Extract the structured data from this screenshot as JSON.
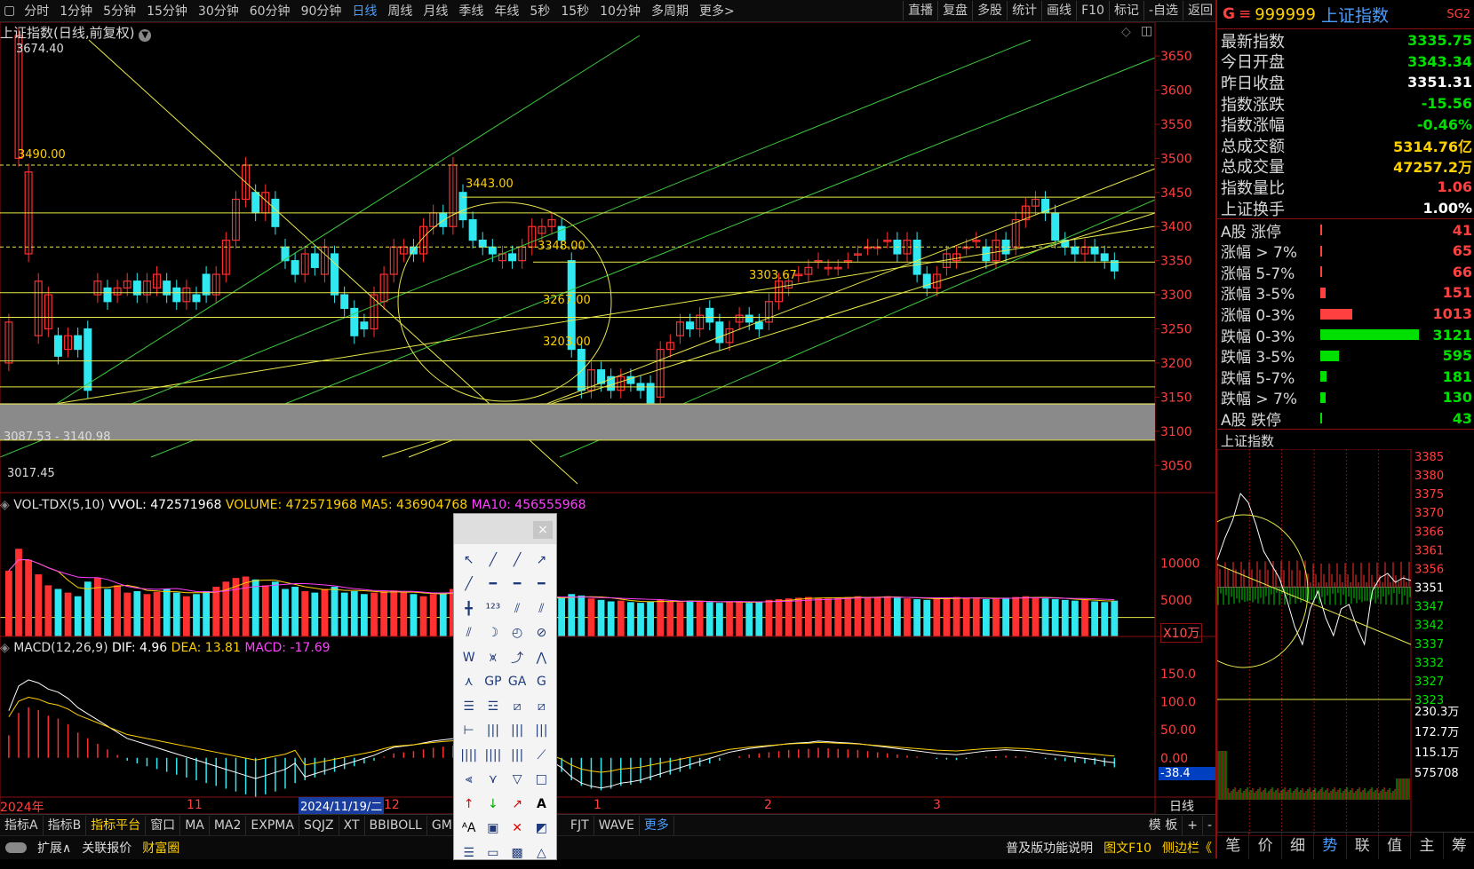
{
  "toolbar": {
    "periods": [
      "分时",
      "1分钟",
      "5分钟",
      "15分钟",
      "30分钟",
      "60分钟",
      "90分钟",
      "日线",
      "周线",
      "月线",
      "季线",
      "年线",
      "5秒",
      "15秒",
      "10分钟",
      "多周期",
      "更多>"
    ],
    "active_period": "日线",
    "right": [
      "直播",
      "复盘",
      "多股",
      "统计",
      "画线",
      "F10",
      "标记",
      "-自选",
      "返回"
    ]
  },
  "main": {
    "title": "上证指数(日线,前复权)",
    "labels": {
      "high": "3674.40",
      "l3490": "3490.00",
      "l3443": "3443.00",
      "l3348": "3348.00",
      "l3303": "3303.67",
      "l3267": "3267.00",
      "l3203": "3203.00",
      "band": "3087.53 - 3140.98",
      "low": "3017.45"
    },
    "vol_header": {
      "name": "VOL-TDX(5,10)",
      "vvol": "VVOL: 472571968",
      "volume": "VOLUME: 472571968",
      "ma5": "MA5: 436904768",
      "ma10": "MA10: 456555968"
    },
    "macd_header": {
      "name": "MACD(12,26,9)",
      "dif": "DIF: 4.96",
      "dea": "DEA: 13.81",
      "macd": "MACD: -17.69"
    },
    "vol_unit": "X10万",
    "macd_cursor": "-38.4",
    "xaxis": {
      "year": "2024年",
      "m11": "11",
      "cursor": "2024/11/19/二",
      "m12": "12",
      "m1": "1",
      "m2": "2",
      "m3": "3",
      "period": "日线"
    }
  },
  "chart_data": {
    "type": "candlestick",
    "y_ticks": [
      "3650",
      "3600",
      "3550",
      "3500",
      "3450",
      "3400",
      "3350",
      "3300",
      "3250",
      "3200",
      "3150",
      "3100",
      "3050"
    ],
    "ylim": [
      3010,
      3680
    ],
    "vol_ticks": [
      "10000",
      "5000"
    ],
    "macd_ticks": [
      "150.0",
      "100.0",
      "50.00",
      "0.00"
    ],
    "closes": [
      3260,
      3680,
      3480,
      3320,
      3300,
      3210,
      3240,
      3220,
      3160,
      3320,
      3290,
      3310,
      3320,
      3300,
      3320,
      3330,
      3300,
      3290,
      3310,
      3290,
      3300,
      3330,
      3380,
      3440,
      3490,
      3420,
      3450,
      3400,
      3350,
      3330,
      3360,
      3340,
      3370,
      3300,
      3280,
      3240,
      3250,
      3300,
      3330,
      3370,
      3370,
      3360,
      3400,
      3420,
      3400,
      3490,
      3410,
      3380,
      3370,
      3360,
      3360,
      3350,
      3370,
      3400,
      3400,
      3410,
      3380,
      3220,
      3160,
      3190,
      3170,
      3160,
      3180,
      3170,
      3160,
      3140,
      3220,
      3230,
      3260,
      3250,
      3270,
      3260,
      3230,
      3250,
      3270,
      3260,
      3250,
      3290,
      3320,
      3320,
      3330,
      3340,
      3350,
      3340,
      3340,
      3350,
      3360,
      3370,
      3370,
      3380,
      3360,
      3380,
      3330,
      3310,
      3330,
      3360,
      3360,
      3370,
      3380,
      3350,
      3380,
      3360,
      3410,
      3430,
      3440,
      3420,
      3380,
      3370,
      3360,
      3370,
      3360,
      3350,
      3335
    ],
    "opens": [
      3200,
      3500,
      3360,
      3240,
      3250,
      3240,
      3220,
      3240,
      3250,
      3300,
      3310,
      3300,
      3310,
      3320,
      3300,
      3310,
      3320,
      3310,
      3290,
      3300,
      3330,
      3300,
      3330,
      3380,
      3440,
      3450,
      3420,
      3440,
      3370,
      3350,
      3330,
      3360,
      3330,
      3360,
      3300,
      3280,
      3260,
      3250,
      3290,
      3330,
      3360,
      3370,
      3360,
      3400,
      3420,
      3400,
      3450,
      3410,
      3380,
      3370,
      3350,
      3360,
      3350,
      3370,
      3390,
      3400,
      3400,
      3350,
      3220,
      3160,
      3190,
      3180,
      3160,
      3180,
      3170,
      3170,
      3150,
      3220,
      3240,
      3260,
      3250,
      3280,
      3260,
      3230,
      3260,
      3270,
      3260,
      3260,
      3290,
      3310,
      3330,
      3330,
      3350,
      3340,
      3340,
      3350,
      3360,
      3370,
      3370,
      3380,
      3380,
      3360,
      3380,
      3330,
      3310,
      3340,
      3350,
      3370,
      3380,
      3370,
      3350,
      3380,
      3370,
      3410,
      3430,
      3440,
      3420,
      3380,
      3370,
      3360,
      3370,
      3360,
      3350
    ],
    "volumes": [
      9000,
      12000,
      10500,
      8500,
      7000,
      6500,
      6000,
      5500,
      7500,
      8000,
      6500,
      7000,
      6000,
      6200,
      5800,
      6100,
      6500,
      6000,
      5500,
      5800,
      6200,
      6800,
      7500,
      8000,
      8200,
      7800,
      7000,
      7500,
      6500,
      6800,
      6200,
      6000,
      6500,
      6800,
      6000,
      6200,
      5800,
      6000,
      6200,
      6300,
      6000,
      5800,
      5500,
      5800,
      6000,
      6500,
      6200,
      5800,
      5500,
      5600,
      5400,
      5200,
      5500,
      5300,
      5000,
      5200,
      5400,
      5800,
      5600,
      5200,
      5000,
      4800,
      4900,
      4700,
      4600,
      4800,
      5000,
      4800,
      4700,
      4900,
      4800,
      4700,
      4600,
      4800,
      4700,
      4600,
      4800,
      5000,
      5100,
      5200,
      5300,
      5400,
      5300,
      5200,
      5300,
      5400,
      5500,
      5300,
      5400,
      5500,
      5300,
      5200,
      5100,
      5000,
      5200,
      5300,
      5400,
      5300,
      5200,
      5100,
      5200,
      5300,
      5400,
      5500,
      5300,
      5200,
      5100,
      5000,
      4900,
      5000,
      4800,
      4700,
      4900
    ],
    "macd_hist": [
      40,
      80,
      90,
      85,
      75,
      70,
      60,
      45,
      35,
      25,
      15,
      5,
      -5,
      -10,
      -15,
      -20,
      -25,
      -30,
      -35,
      -40,
      -45,
      -50,
      -55,
      -60,
      -65,
      -70,
      -65,
      -60,
      -55,
      -45,
      -40,
      -35,
      -30,
      -25,
      -20,
      -15,
      -10,
      -5,
      2,
      8,
      10,
      12,
      15,
      18,
      20,
      22,
      18,
      14,
      10,
      6,
      2,
      -2,
      -5,
      -8,
      -10,
      -15,
      -25,
      -40,
      -50,
      -55,
      -58,
      -55,
      -50,
      -48,
      -45,
      -40,
      -35,
      -30,
      -25,
      -20,
      -15,
      -10,
      -5,
      0,
      3,
      6,
      8,
      10,
      12,
      14,
      15,
      16,
      18,
      17,
      16,
      15,
      14,
      12,
      10,
      8,
      6,
      4,
      2,
      0,
      -2,
      -3,
      -4,
      -2,
      0,
      2,
      3,
      4,
      3,
      2,
      0,
      -2,
      -4,
      -6,
      -8,
      -10,
      -12,
      -15,
      -17
    ],
    "trend": {
      "label": "上证指数",
      "ticks": [
        "3385",
        "3380",
        "3375",
        "3370",
        "3366",
        "3361",
        "3356",
        "3351",
        "3347",
        "3342",
        "3337",
        "3332",
        "3327",
        "3323"
      ],
      "vol_ticks": [
        "230.3万",
        "172.7万",
        "115.1万",
        "575708"
      ]
    }
  },
  "quote": {
    "code": "999999",
    "name": "上证指数",
    "badge": "SG2",
    "prefix": "G",
    "rows": [
      {
        "label": "最新指数",
        "value": "3335.75",
        "color": "#00e000"
      },
      {
        "label": "今日开盘",
        "value": "3343.34",
        "color": "#00e000"
      },
      {
        "label": "昨日收盘",
        "value": "3351.31",
        "color": "#ffffff"
      },
      {
        "label": "指数涨跌",
        "value": "-15.56",
        "color": "#00e000"
      },
      {
        "label": "指数涨幅",
        "value": "-0.46%",
        "color": "#00e000"
      },
      {
        "label": "总成交额",
        "value": "5314.76亿",
        "color": "#ffd000"
      },
      {
        "label": "总成交量",
        "value": "47257.2万",
        "color": "#ffd000"
      },
      {
        "label": "指数量比",
        "value": "1.06",
        "color": "#ff4040"
      },
      {
        "label": "上证换手",
        "value": "1.00%",
        "color": "#ffffff"
      }
    ],
    "breadth": [
      {
        "label": "A股 涨停",
        "count": "41",
        "color": "#ff4040",
        "frac": 0.02
      },
      {
        "label": "涨幅 > 7%",
        "count": "65",
        "color": "#ff4040",
        "frac": 0.02
      },
      {
        "label": "涨幅 5-7%",
        "count": "66",
        "color": "#ff4040",
        "frac": 0.02
      },
      {
        "label": "涨幅 3-5%",
        "count": "151",
        "color": "#ff4040",
        "frac": 0.05
      },
      {
        "label": "涨幅 0-3%",
        "count": "1013",
        "color": "#ff4040",
        "frac": 0.32
      },
      {
        "label": "跌幅 0-3%",
        "count": "3121",
        "color": "#00e000",
        "frac": 1.0
      },
      {
        "label": "跌幅 3-5%",
        "count": "595",
        "color": "#00e000",
        "frac": 0.19
      },
      {
        "label": "跌幅 5-7%",
        "count": "181",
        "color": "#00e000",
        "frac": 0.06
      },
      {
        "label": "跌幅 > 7%",
        "count": "130",
        "color": "#00e000",
        "frac": 0.05
      },
      {
        "label": "A股 跌停",
        "count": "43",
        "color": "#00e000",
        "frac": 0.02
      }
    ],
    "tabs": [
      "笔",
      "价",
      "细",
      "势",
      "联",
      "值",
      "主",
      "筹"
    ],
    "active_tab": "势"
  },
  "bottombar": {
    "items": [
      "指标A",
      "指标B",
      "指标平台",
      "窗口",
      "MA",
      "MA2",
      "EXPMA",
      "SQJZ",
      "XT",
      "BBIBOLL",
      "GMI",
      "FJT",
      "WAVE",
      "更多"
    ],
    "right": [
      "模 板",
      "+",
      "-"
    ]
  },
  "statusbar": {
    "items": [
      "扩展∧",
      "关联报价",
      "财富圈"
    ],
    "right": [
      "普及版功能说明",
      "图文F10",
      "侧边栏《"
    ]
  },
  "palette": {
    "close": "×",
    "text_tool": "A",
    "text_tool2": "ᴬA"
  }
}
